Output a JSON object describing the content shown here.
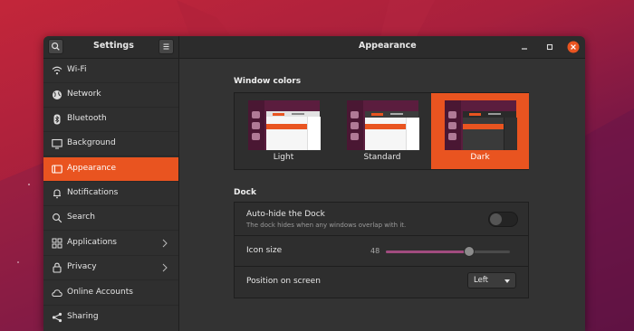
{
  "colors": {
    "accent": "#e95420",
    "window_bg": "#353535",
    "sidebar_bg": "#2f2f2f",
    "header_bg": "#2c2c2c"
  },
  "header": {
    "settings_title": "Settings",
    "page_title": "Appearance",
    "icons": [
      "search-icon",
      "hamburger-menu-icon",
      "minimize-icon",
      "maximize-icon",
      "close-icon"
    ]
  },
  "sidebar": {
    "items": [
      {
        "label": "Wi-Fi",
        "icon": "wifi-icon"
      },
      {
        "label": "Network",
        "icon": "network-icon"
      },
      {
        "label": "Bluetooth",
        "icon": "bluetooth-icon"
      },
      {
        "label": "Background",
        "icon": "background-icon"
      },
      {
        "label": "Appearance",
        "icon": "appearance-icon",
        "active": true
      },
      {
        "label": "Notifications",
        "icon": "bell-icon"
      },
      {
        "label": "Search",
        "icon": "search-icon"
      },
      {
        "label": "Applications",
        "icon": "apps-grid-icon",
        "has_submenu": true
      },
      {
        "label": "Privacy",
        "icon": "lock-icon",
        "has_submenu": true
      },
      {
        "label": "Online Accounts",
        "icon": "cloud-icon"
      },
      {
        "label": "Sharing",
        "icon": "share-icon"
      }
    ]
  },
  "window_colors": {
    "title": "Window colors",
    "options": [
      {
        "label": "Light"
      },
      {
        "label": "Standard"
      },
      {
        "label": "Dark",
        "selected": true
      }
    ]
  },
  "dock": {
    "title": "Dock",
    "autohide": {
      "label": "Auto-hide the Dock",
      "description": "The dock hides when any windows overlap with it.",
      "enabled": false
    },
    "icon_size": {
      "label": "Icon size",
      "value": "48",
      "slider_fraction": 0.67
    },
    "position": {
      "label": "Position on screen",
      "value": "Left"
    }
  }
}
